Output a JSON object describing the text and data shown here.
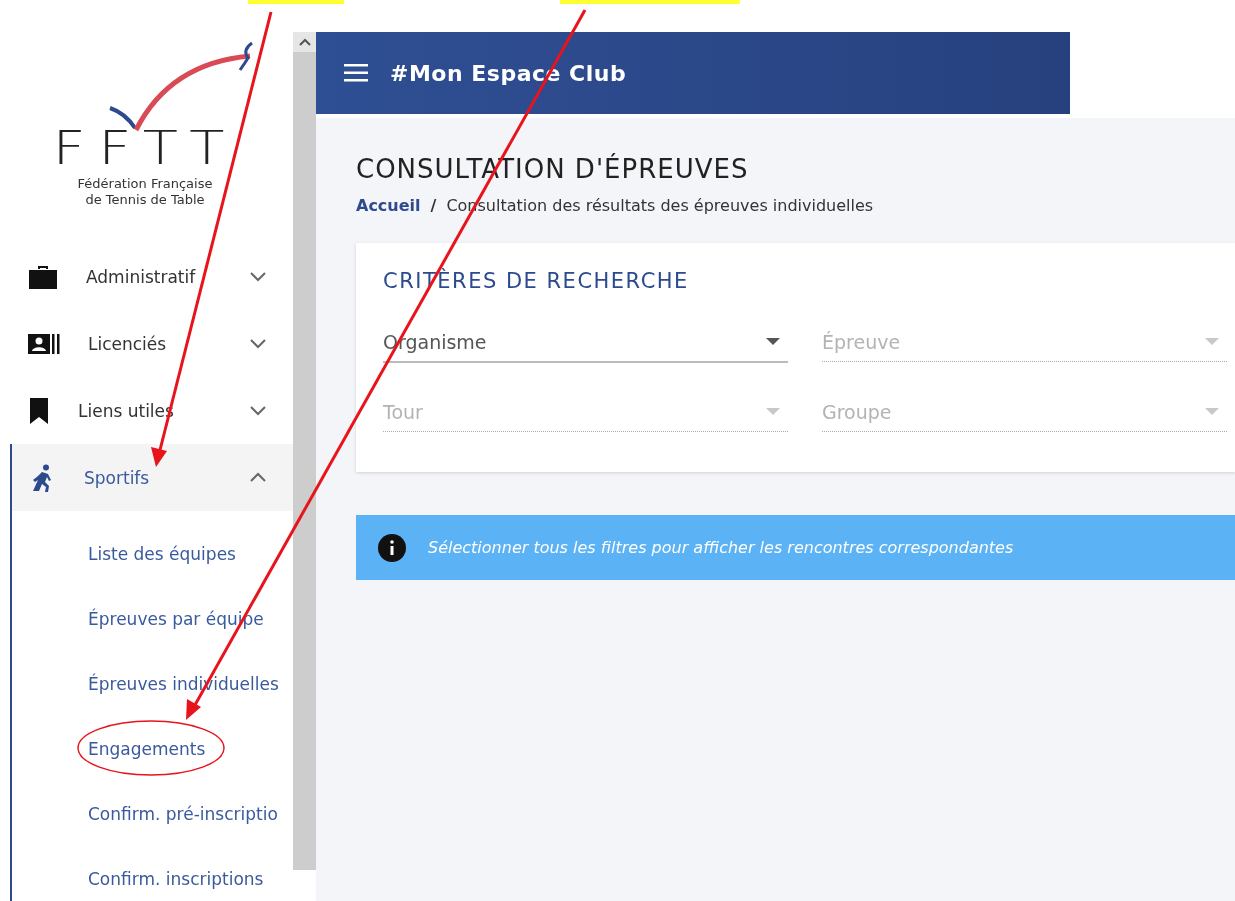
{
  "logo": {
    "wordmark": "FFTT",
    "subtitle": [
      "Fédération Française",
      "de Tennis de Table"
    ]
  },
  "sidebar": {
    "items": [
      {
        "label": "Administratif",
        "expanded": false,
        "selected": false
      },
      {
        "label": "Licenciés",
        "expanded": false,
        "selected": false
      },
      {
        "label": "Liens utiles",
        "expanded": false,
        "selected": false
      },
      {
        "label": "Sportifs",
        "expanded": true,
        "selected": true,
        "children": [
          {
            "label": "Liste des équipes"
          },
          {
            "label": "Épreuves par équipe"
          },
          {
            "label": "Épreuves individuelles"
          },
          {
            "label": "Engagements"
          },
          {
            "label": "Confirm. pré-inscriptio"
          },
          {
            "label": "Confirm. inscriptions"
          }
        ]
      }
    ]
  },
  "header": {
    "title": "#Mon Espace Club"
  },
  "page": {
    "title": "CONSULTATION D'ÉPREUVES",
    "breadcrumb": [
      "Accueil",
      "Consultation des résultats des épreuves individuelles"
    ],
    "breadcrumb_separator": "/"
  },
  "search_card": {
    "title": "CRITÈRES DE RECHERCHE",
    "fields": [
      {
        "placeholder": "Organisme",
        "disabled": false
      },
      {
        "placeholder": "Épreuve",
        "disabled": true
      },
      {
        "placeholder": "Tour",
        "disabled": true
      },
      {
        "placeholder": "Groupe",
        "disabled": true
      }
    ]
  },
  "info": {
    "message": "Sélectionner tous les filtres pour afficher les rencontres correspondantes"
  }
}
